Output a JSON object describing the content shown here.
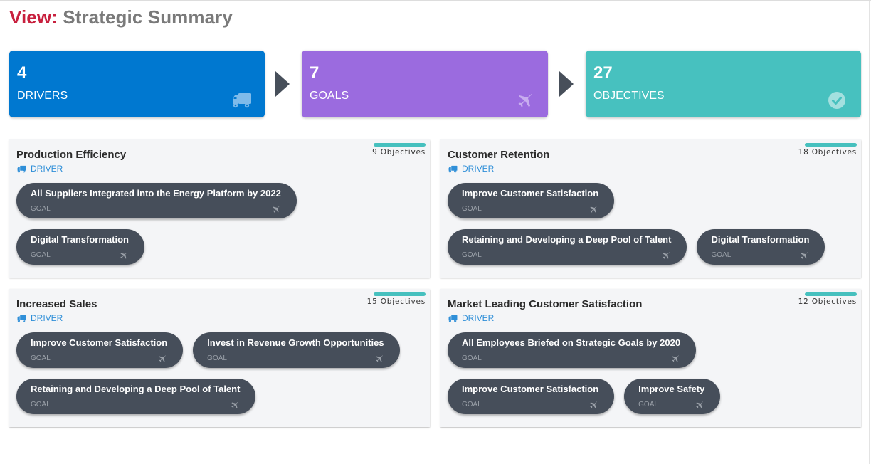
{
  "header": {
    "prefix": "View:",
    "title": "Strategic Summary"
  },
  "stats": [
    {
      "count": "4",
      "label": "DRIVERS",
      "icon": "truck-icon",
      "color": "#0078d0"
    },
    {
      "count": "7",
      "label": "GOALS",
      "icon": "plane-icon",
      "color": "#9b6bdf"
    },
    {
      "count": "27",
      "label": "OBJECTIVES",
      "icon": "check-circle-icon",
      "color": "#47c1bf"
    }
  ],
  "drivers": [
    {
      "name": "Production Efficiency",
      "type": "DRIVER",
      "objectives": "9 Objectives",
      "goals": [
        {
          "name": "All Suppliers Integrated into the Energy Platform by 2022",
          "type": "GOAL"
        },
        {
          "name": "Digital Transformation",
          "type": "GOAL"
        }
      ]
    },
    {
      "name": "Customer Retention",
      "type": "DRIVER",
      "objectives": "18 Objectives",
      "goals": [
        {
          "name": "Improve Customer Satisfaction",
          "type": "GOAL"
        },
        {
          "name": "Retaining and Developing a Deep Pool of Talent",
          "type": "GOAL"
        },
        {
          "name": "Digital Transformation",
          "type": "GOAL"
        }
      ]
    },
    {
      "name": "Increased Sales",
      "type": "DRIVER",
      "objectives": "15 Objectives",
      "goals": [
        {
          "name": "Improve Customer Satisfaction",
          "type": "GOAL"
        },
        {
          "name": "Invest in Revenue Growth Opportunities",
          "type": "GOAL"
        },
        {
          "name": "Retaining and Developing a Deep Pool of Talent",
          "type": "GOAL"
        }
      ]
    },
    {
      "name": "Market Leading Customer Satisfaction",
      "type": "DRIVER",
      "objectives": "12 Objectives",
      "goals": [
        {
          "name": "All Employees Briefed on Strategic Goals by 2020",
          "type": "GOAL"
        },
        {
          "name": "Improve Customer Satisfaction",
          "type": "GOAL"
        },
        {
          "name": "Improve Safety",
          "type": "GOAL"
        }
      ]
    }
  ]
}
